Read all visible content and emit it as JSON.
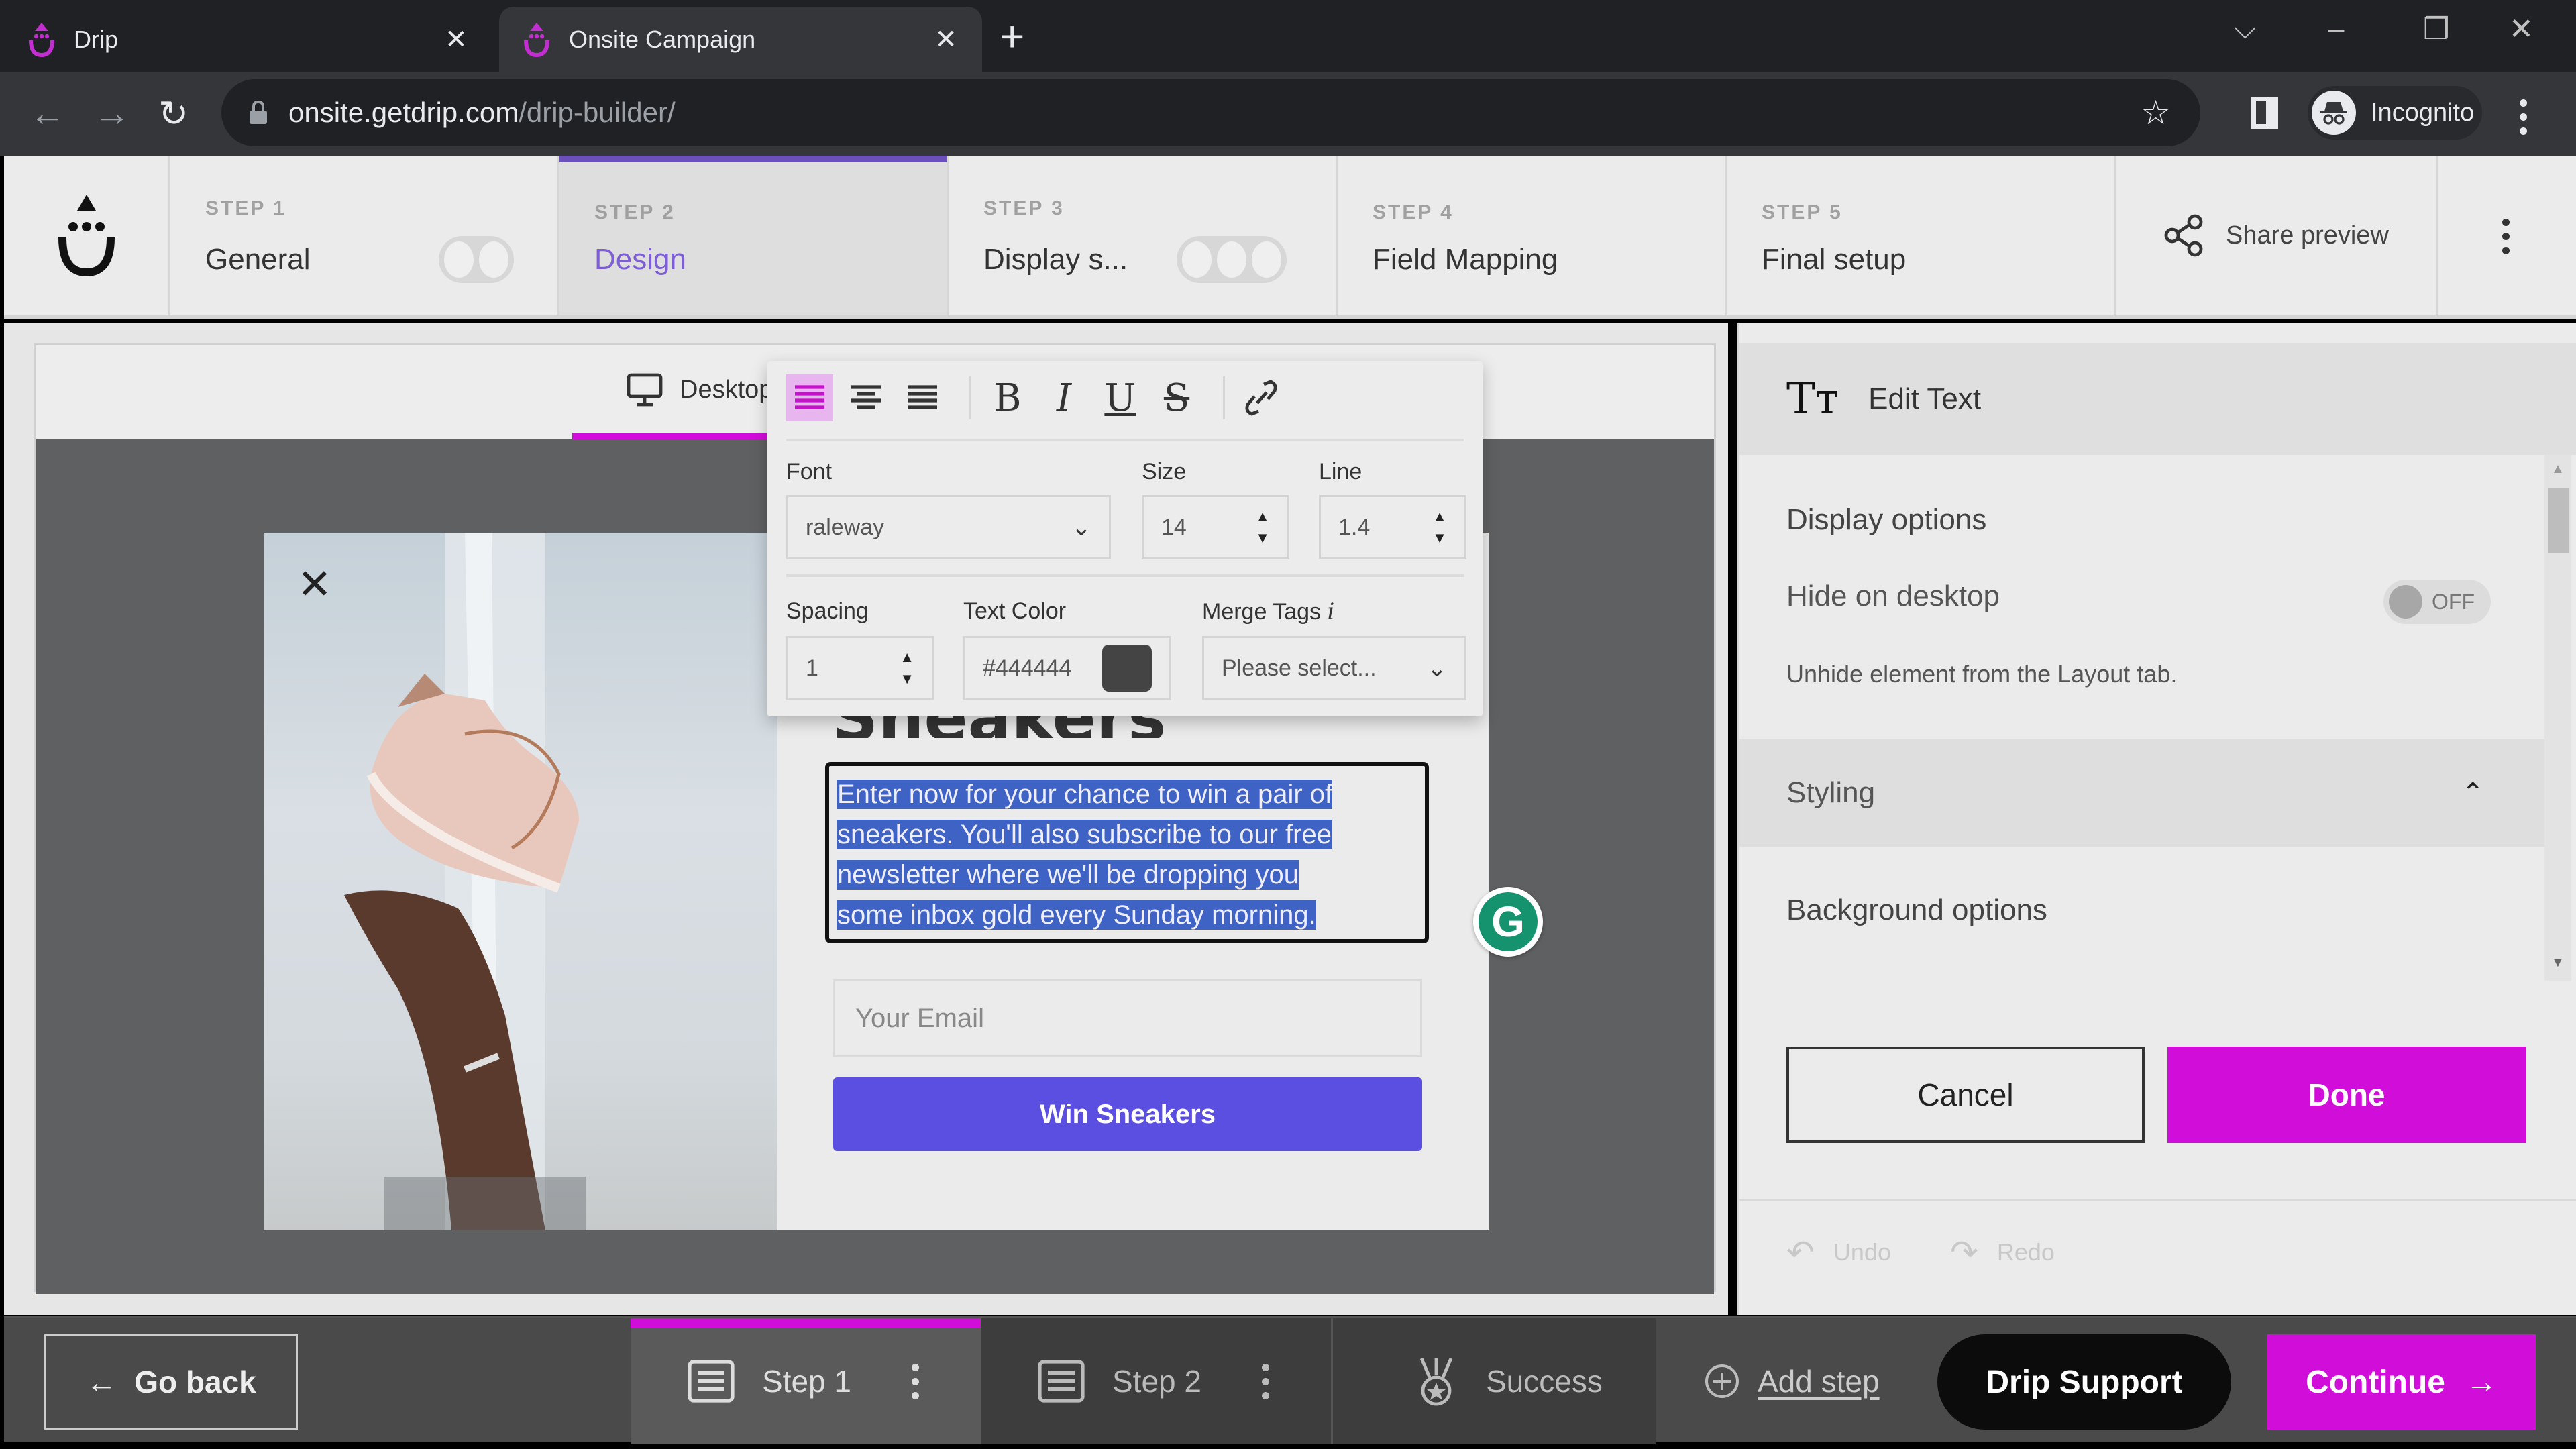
{
  "browser": {
    "tabs": [
      {
        "title": "Drip",
        "active": false
      },
      {
        "title": "Onsite Campaign",
        "active": true
      }
    ],
    "new_tab_label": "+",
    "url_host": "onsite.getdrip.com",
    "url_path": "/drip-builder/",
    "profile_label": "Incognito"
  },
  "header": {
    "steps": [
      {
        "num": "STEP 1",
        "label": "General",
        "toggle_dots": 2
      },
      {
        "num": "STEP 2",
        "label": "Design",
        "active": true
      },
      {
        "num": "STEP 3",
        "label": "Display s...",
        "toggle_dots": 3
      },
      {
        "num": "STEP 4",
        "label": "Field Mapping"
      },
      {
        "num": "STEP 5",
        "label": "Final setup"
      }
    ],
    "share_label": "Share preview"
  },
  "canvas": {
    "device_tab": "Desktop",
    "popup": {
      "heading_peek": "Sneakers",
      "body_lines": [
        "Enter now for your chance to win a pair of",
        "sneakers. You'll also subscribe to our free",
        "newsletter where we'll be dropping you",
        "some inbox gold every Sunday morning."
      ],
      "email_placeholder": "Your Email",
      "cta_label": "Win Sneakers",
      "close_glyph": "✕"
    },
    "grammarly_glyph": "G"
  },
  "text_toolbar": {
    "font_label": "Font",
    "font_value": "raleway",
    "size_label": "Size",
    "size_value": "14",
    "line_label": "Line",
    "line_value": "1.4",
    "spacing_label": "Spacing",
    "spacing_value": "1",
    "color_label": "Text Color",
    "color_value": "#444444",
    "merge_label": "Merge Tags",
    "merge_info": "i",
    "merge_value": "Please select...",
    "align_active": "left",
    "swatch_color": "#444444"
  },
  "right_panel": {
    "title": "Edit Text",
    "display_options": "Display options",
    "hide_on_desktop": "Hide on desktop",
    "toggle_state": "OFF",
    "hint": "Unhide element from the Layout tab.",
    "styling": "Styling",
    "background_options": "Background options",
    "cancel": "Cancel",
    "done": "Done",
    "undo": "Undo",
    "redo": "Redo"
  },
  "bottom_bar": {
    "go_back": "Go back",
    "steps": [
      {
        "label": "Step 1",
        "active": true
      },
      {
        "label": "Step 2"
      }
    ],
    "success": "Success",
    "add_step": "Add step",
    "support": "Drip Support",
    "continue": "Continue"
  },
  "colors": {
    "accent_magenta": "#d10ed9",
    "design_purple": "#6b4fbb",
    "cta_blue": "#5a4fe0",
    "selection_blue": "#3f63c5"
  }
}
